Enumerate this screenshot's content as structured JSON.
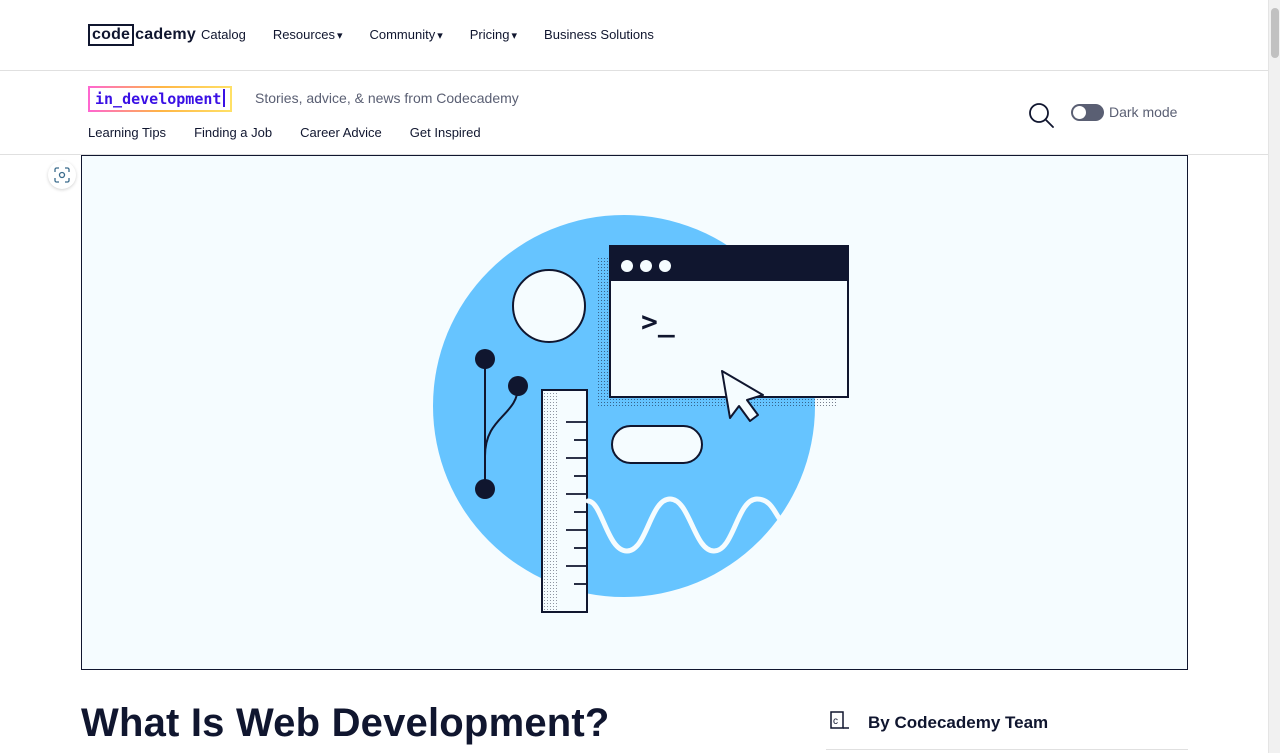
{
  "topnav": {
    "logo": {
      "boxed": "code",
      "rest": "cademy"
    },
    "items": [
      {
        "label": "Catalog",
        "dropdown": false
      },
      {
        "label": "Resources",
        "dropdown": true
      },
      {
        "label": "Community",
        "dropdown": true
      },
      {
        "label": "Pricing",
        "dropdown": true
      },
      {
        "label": "Business Solutions",
        "dropdown": false
      }
    ],
    "caret": "▾"
  },
  "blog": {
    "badge": "in_development",
    "tagline": "Stories, advice, & news from Codecademy",
    "categories": [
      "Learning Tips",
      "Finding a Job",
      "Career Advice",
      "Get Inspired"
    ],
    "dark_mode_label": "Dark mode",
    "dark_mode_on": false
  },
  "hero": {
    "prompt_text": ">_",
    "colors": {
      "background": "#f5fcff",
      "circle": "#66c4ff",
      "ink": "#10162f"
    }
  },
  "article": {
    "title": "What Is Web Development?",
    "author": "By Codecademy Team"
  },
  "icons": {
    "search": "search-icon",
    "image_action": "image-focus-icon",
    "author": "codecademy-c-icon"
  }
}
